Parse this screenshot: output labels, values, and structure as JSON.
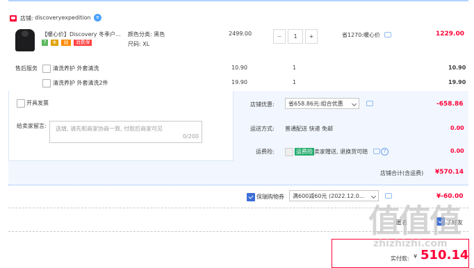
{
  "store": {
    "prefix": "店铺:",
    "name": "discoveryexpedition",
    "wangwang_glyph": "e"
  },
  "item": {
    "title": "【暖心价】Discovery 冬季户...",
    "badges": [
      {
        "text": "7",
        "color": "#5bb85d"
      },
      {
        "text": "⊕",
        "color": "#e0a100"
      },
      {
        "text": "▤",
        "color": "#ff8a00"
      },
      {
        "text": "消费保",
        "color": "#ff3d3d"
      }
    ],
    "color_label": "颜色分类: 黑色",
    "size_label": "尺码: XL",
    "unit_price": "2499.00",
    "qty_minus": "−",
    "qty": "1",
    "qty_plus": "+",
    "saving": "省1270:暖心价",
    "total": "1229.00"
  },
  "services": {
    "label": "售后服务",
    "rows": [
      {
        "name": "清洗养护 外套清洗",
        "price": "10.90",
        "qty": "1",
        "total": "10.90"
      },
      {
        "name": "清洗养护 外套清洗2件",
        "price": "19.90",
        "qty": "1",
        "total": "19.90"
      }
    ]
  },
  "invoice": {
    "label": "开具发票"
  },
  "message": {
    "label": "给卖家留言:",
    "placeholder": "选填, 请先和商家协商一致, 付款后商家可见",
    "counter": "0/200"
  },
  "store_discount": {
    "label": "店铺优惠:",
    "option": "省658.86元:组合优惠",
    "amount": "-658.86"
  },
  "delivery": {
    "label": "运送方式:",
    "value": "普通配送 快递 免邮",
    "amount": "0.00"
  },
  "insurance": {
    "label": "运费险:",
    "tag": "运费险",
    "desc": "卖家赠送, 退换货可赔",
    "amount": "0.00"
  },
  "store_total": {
    "label": "店铺合计(含运费)",
    "amount": "¥570.14"
  },
  "coupon": {
    "label": "保瑞购物券",
    "option": "满600减60元 (2022.12.0...",
    "amount": "¥-60.00"
  },
  "partial_row": {
    "left": "匿名",
    "right": "了好友"
  },
  "payment": {
    "label": "实付款:",
    "symbol": "¥",
    "amount": "510.14"
  },
  "watermark": {
    "big": "值值值",
    "small": "zhizhizhi.com"
  },
  "colors": {
    "accent_red": "#ff0036",
    "link_blue": "#3d6ed8",
    "panel_bg": "#f2f7ff"
  }
}
